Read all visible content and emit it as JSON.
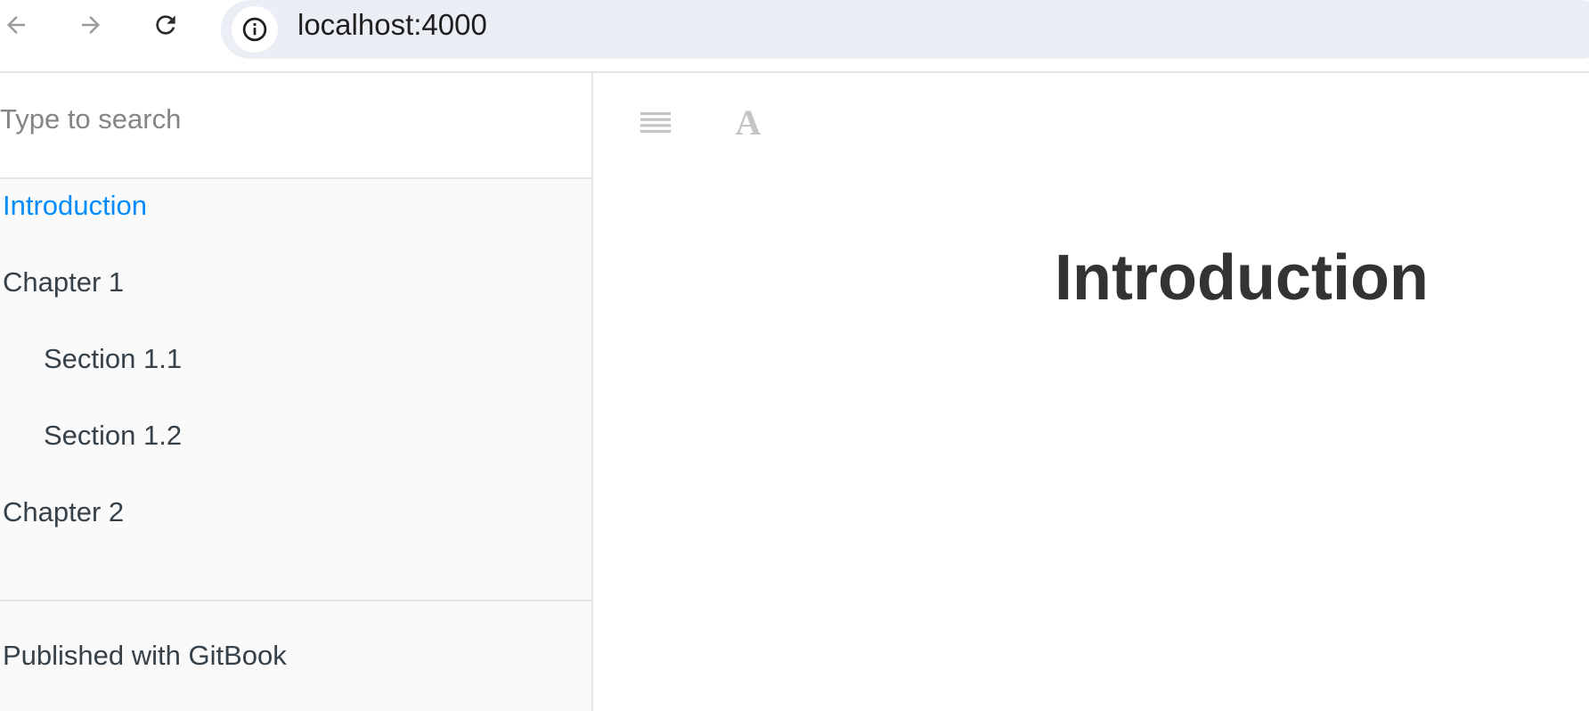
{
  "browser": {
    "url": "localhost:4000",
    "back_icon": "arrow-left-icon",
    "forward_icon": "arrow-right-icon",
    "reload_icon": "reload-icon",
    "site_info_icon": "info-circle-icon"
  },
  "sidebar": {
    "search_placeholder": "Type to search",
    "items": [
      {
        "label": "Introduction",
        "level": 1,
        "active": true
      },
      {
        "label": "Chapter 1",
        "level": 1,
        "active": false
      },
      {
        "label": "Section 1.1",
        "level": 2,
        "active": false
      },
      {
        "label": "Section 1.2",
        "level": 2,
        "active": false
      },
      {
        "label": "Chapter 2",
        "level": 1,
        "active": false
      }
    ],
    "footer_link": "Published with GitBook"
  },
  "header": {
    "toggle_icon": "hamburger-menu-icon",
    "font_settings_icon": "font-settings-icon",
    "font_glyph": "A"
  },
  "page": {
    "title": "Introduction"
  },
  "colors": {
    "active_link": "#008cff",
    "text": "#364149",
    "sidebar_bg": "#fafafa",
    "omnibox_bg": "#ebeef5"
  }
}
